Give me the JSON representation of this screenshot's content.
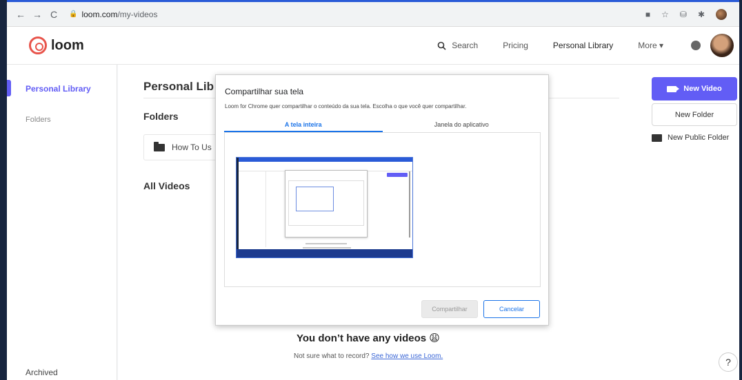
{
  "browser": {
    "back_icon": "←",
    "forward_icon": "→",
    "reload_icon": "C",
    "url_domain": "loom.com",
    "url_path": "/my-videos"
  },
  "header": {
    "logo_text": "loom",
    "search_label": "Search",
    "nav_pricing": "Pricing",
    "nav_personal": "Personal Library",
    "nav_more": "More ▾"
  },
  "sidebar": {
    "personal": "Personal Library",
    "folders": "Folders",
    "archived": "Archived"
  },
  "main": {
    "page_title": "Personal Lib",
    "folders_title": "Folders",
    "folder_name": "How To Us",
    "all_videos_title": "All Videos",
    "empty_title": "You don’t have any videos 😩",
    "empty_sub": "Not sure what to record?",
    "empty_link": "See how we use Loom."
  },
  "actions": {
    "new_video": "New Video",
    "new_folder": "New Folder",
    "new_public_folder": "New Public Folder",
    "help": "?"
  },
  "dialog": {
    "title": "Compartilhar sua tela",
    "description": "Loom for Chrome quer compartilhar o conteúdo da sua tela. Escolha o que você quer compartilhar.",
    "tab_entire": "A tela inteira",
    "tab_app": "Janela do aplicativo",
    "share_button": "Compartilhar",
    "cancel_button": "Cancelar"
  },
  "colors": {
    "accent": "#625df5",
    "chrome_blue": "#1a73e8",
    "frame": "#17253f"
  }
}
